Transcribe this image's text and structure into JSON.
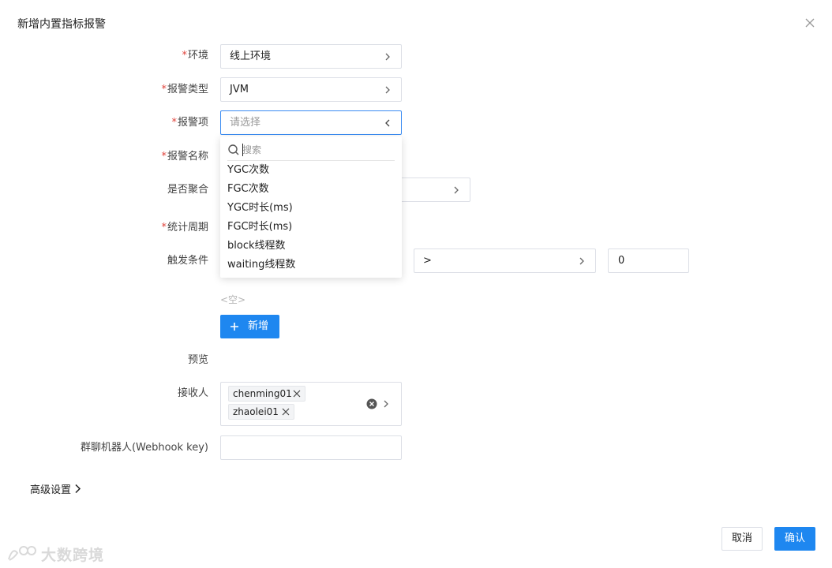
{
  "dialog": {
    "title": "新增内置指标报警",
    "required_mark": "*"
  },
  "form": {
    "env": {
      "label": "环境",
      "value": "线上环境"
    },
    "alert_type": {
      "label": "报警类型",
      "value": "JVM"
    },
    "alert_item": {
      "label": "报警项",
      "placeholder": "请选择"
    },
    "alert_name": {
      "label": "报警名称"
    },
    "aggregate": {
      "label": "是否聚合"
    },
    "period": {
      "label": "统计周期"
    },
    "trigger": {
      "label": "触发条件",
      "operator": ">",
      "threshold": "0"
    },
    "empty_text": "<空>",
    "add_label": "新增",
    "preview": {
      "label": "预览"
    },
    "receivers": {
      "label": "接收人",
      "tags": [
        "chenming01",
        "zhaolei01"
      ]
    },
    "webhook": {
      "label": "群聊机器人(Webhook key)"
    }
  },
  "dropdown": {
    "search_placeholder": "搜索",
    "options": [
      "YGC次数",
      "FGC次数",
      "YGC时长(ms)",
      "FGC时长(ms)",
      "block线程数",
      "waiting线程数"
    ]
  },
  "advanced": {
    "label": "高级设置"
  },
  "footer": {
    "cancel": "取消",
    "confirm": "确认"
  },
  "watermark": {
    "text": "大数跨境"
  },
  "colors": {
    "primary": "#1e87f0",
    "required": "#e0433b",
    "focus_border": "#3b8cf2"
  }
}
